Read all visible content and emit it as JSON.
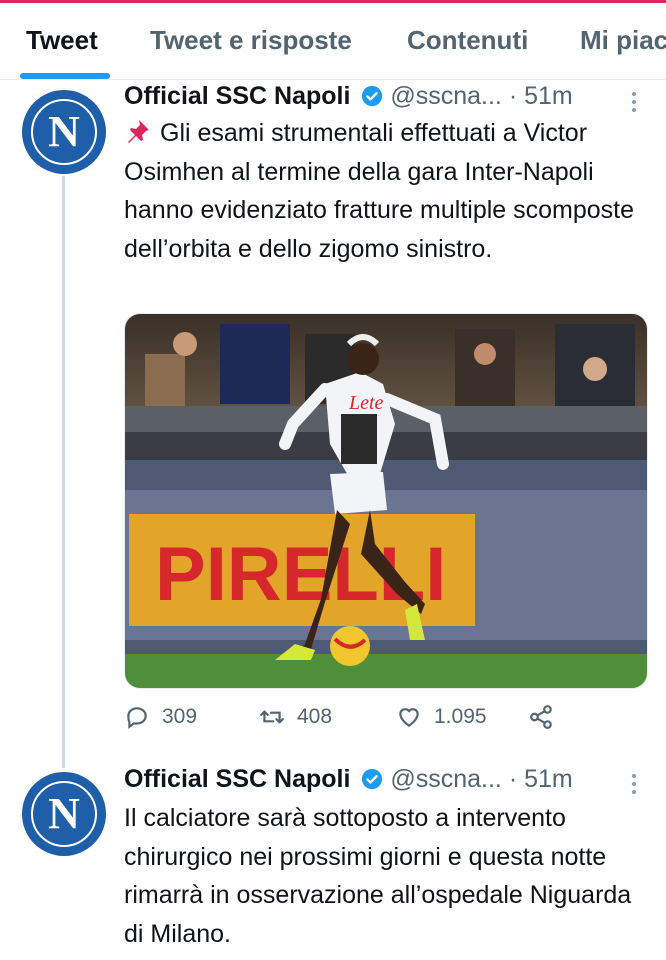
{
  "tabs": [
    {
      "label": "Tweet",
      "active": true
    },
    {
      "label": "Tweet e risposte",
      "active": false
    },
    {
      "label": "Contenuti",
      "active": false
    },
    {
      "label": "Mi piac",
      "active": false
    }
  ],
  "colors": {
    "accent": "#1d9bf0",
    "top_line": "#e0245e",
    "avatar_blue": "#1f5ea8"
  },
  "tweets": [
    {
      "avatar_letter": "N",
      "name": "Official SSC Napoli",
      "handle": "@sscna...",
      "separator": "·",
      "time": "51m",
      "pin_icon": "pushpin-icon",
      "text": "Gli esami strumentali effettuati a Victor Osimhen al termine della gara Inter-Napoli hanno evidenziato fratture multiple scomposte dell’orbita e dello zigomo sinistro.",
      "media": {
        "ad_board_text": "PIRELLI",
        "shirt_sponsor": "Lete"
      },
      "stats": {
        "replies": "309",
        "retweets": "408",
        "likes": "1.095"
      }
    },
    {
      "avatar_letter": "N",
      "name": "Official SSC Napoli",
      "handle": "@sscna...",
      "separator": "·",
      "time": "51m",
      "text": "Il calciatore sarà sottoposto a intervento chirurgico nei prossimi giorni e questa notte rimarrà in osservazione all’ospedale Niguarda di Milano."
    }
  ]
}
